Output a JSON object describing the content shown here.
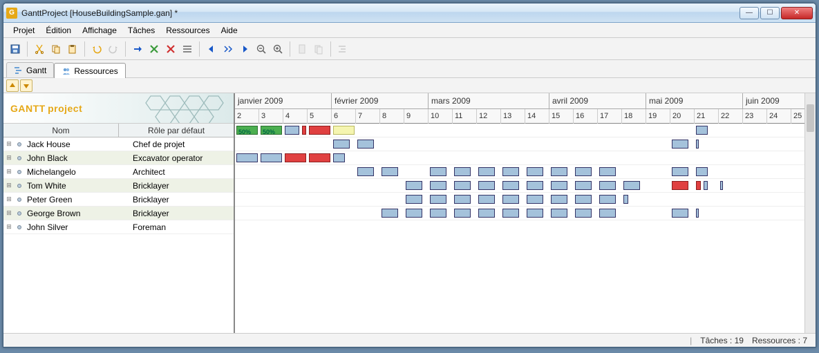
{
  "window": {
    "title": "GanttProject [HouseBuildingSample.gan] *"
  },
  "menu": {
    "projet": "Projet",
    "edition": "Édition",
    "affichage": "Affichage",
    "taches": "Tâches",
    "ressources": "Ressources",
    "aide": "Aide"
  },
  "tabs": {
    "gantt": "Gantt",
    "ressources": "Ressources"
  },
  "columns": {
    "name": "Nom",
    "role": "Rôle par défaut"
  },
  "logo": {
    "main": "GANTT",
    "sub": "project"
  },
  "resources": [
    {
      "name": "Jack House",
      "role": "Chef de projet"
    },
    {
      "name": "John Black",
      "role": "Excavator operator"
    },
    {
      "name": "Michelangelo",
      "role": "Architect"
    },
    {
      "name": "Tom White",
      "role": "Bricklayer"
    },
    {
      "name": "Peter Green",
      "role": "Bricklayer"
    },
    {
      "name": "George Brown",
      "role": "Bricklayer"
    },
    {
      "name": "John Silver",
      "role": "Foreman"
    }
  ],
  "timeline": {
    "months": [
      {
        "label": "janvier 2009",
        "span": 4
      },
      {
        "label": "février 2009",
        "span": 4
      },
      {
        "label": "mars 2009",
        "span": 5
      },
      {
        "label": "avril 2009",
        "span": 4
      },
      {
        "label": "mai 2009",
        "span": 4
      },
      {
        "label": "juin 2009",
        "span": 3
      }
    ],
    "weeks": [
      "2",
      "3",
      "4",
      "5",
      "6",
      "7",
      "8",
      "9",
      "10",
      "11",
      "12",
      "13",
      "14",
      "15",
      "16",
      "17",
      "18",
      "19",
      "20",
      "21",
      "22",
      "23",
      "24",
      "25"
    ],
    "week_width": 35
  },
  "chart_data": {
    "type": "gantt",
    "unit": "week-index",
    "rows": [
      {
        "resource": "Jack House",
        "bars": [
          {
            "start": 0,
            "span": 1,
            "color": "green",
            "label": "50%"
          },
          {
            "start": 1,
            "span": 1,
            "color": "green",
            "label": "50%"
          },
          {
            "start": 2,
            "span": 0.7,
            "color": "blue"
          },
          {
            "start": 2.7,
            "span": 0.3,
            "color": "red"
          },
          {
            "start": 3,
            "span": 1,
            "color": "red"
          },
          {
            "start": 4,
            "span": 1,
            "color": "yellow"
          },
          {
            "start": 19,
            "span": 0.6,
            "color": "blue"
          }
        ]
      },
      {
        "resource": "John Black",
        "bars": [
          {
            "start": 4,
            "span": 0.8,
            "color": "blue"
          },
          {
            "start": 5,
            "span": 0.8,
            "color": "blue"
          },
          {
            "start": 18,
            "span": 0.8,
            "color": "blue"
          },
          {
            "start": 19,
            "span": 0.15,
            "color": "blue"
          }
        ]
      },
      {
        "resource": "Michelangelo",
        "bars": [
          {
            "start": 0,
            "span": 1,
            "color": "blue"
          },
          {
            "start": 1,
            "span": 1,
            "color": "blue"
          },
          {
            "start": 2,
            "span": 1,
            "color": "red"
          },
          {
            "start": 3,
            "span": 1,
            "color": "red"
          },
          {
            "start": 4,
            "span": 0.6,
            "color": "blue"
          }
        ]
      },
      {
        "resource": "Tom White",
        "bars": [
          {
            "start": 5,
            "span": 0.8,
            "color": "blue"
          },
          {
            "start": 6,
            "span": 0.8,
            "color": "blue"
          },
          {
            "start": 8,
            "span": 0.8,
            "color": "blue"
          },
          {
            "start": 9,
            "span": 0.8,
            "color": "blue"
          },
          {
            "start": 10,
            "span": 0.8,
            "color": "blue"
          },
          {
            "start": 11,
            "span": 0.8,
            "color": "blue"
          },
          {
            "start": 12,
            "span": 0.8,
            "color": "blue"
          },
          {
            "start": 13,
            "span": 0.8,
            "color": "blue"
          },
          {
            "start": 14,
            "span": 0.8,
            "color": "blue"
          },
          {
            "start": 15,
            "span": 0.8,
            "color": "blue"
          },
          {
            "start": 18,
            "span": 0.8,
            "color": "blue"
          },
          {
            "start": 19,
            "span": 0.6,
            "color": "blue"
          }
        ]
      },
      {
        "resource": "Peter Green",
        "bars": [
          {
            "start": 7,
            "span": 0.8,
            "color": "blue"
          },
          {
            "start": 8,
            "span": 0.8,
            "color": "blue"
          },
          {
            "start": 9,
            "span": 0.8,
            "color": "blue"
          },
          {
            "start": 10,
            "span": 0.8,
            "color": "blue"
          },
          {
            "start": 11,
            "span": 0.8,
            "color": "blue"
          },
          {
            "start": 12,
            "span": 0.8,
            "color": "blue"
          },
          {
            "start": 13,
            "span": 0.8,
            "color": "blue"
          },
          {
            "start": 14,
            "span": 0.8,
            "color": "blue"
          },
          {
            "start": 15,
            "span": 0.8,
            "color": "blue"
          },
          {
            "start": 16,
            "span": 0.8,
            "color": "blue"
          },
          {
            "start": 18,
            "span": 0.8,
            "color": "red"
          },
          {
            "start": 19,
            "span": 0.3,
            "color": "red"
          },
          {
            "start": 19.3,
            "span": 0.3,
            "color": "blue"
          },
          {
            "start": 20,
            "span": 0.15,
            "color": "blue"
          }
        ]
      },
      {
        "resource": "George Brown",
        "bars": [
          {
            "start": 7,
            "span": 0.8,
            "color": "blue"
          },
          {
            "start": 8,
            "span": 0.8,
            "color": "blue"
          },
          {
            "start": 9,
            "span": 0.8,
            "color": "blue"
          },
          {
            "start": 10,
            "span": 0.8,
            "color": "blue"
          },
          {
            "start": 11,
            "span": 0.8,
            "color": "blue"
          },
          {
            "start": 12,
            "span": 0.8,
            "color": "blue"
          },
          {
            "start": 13,
            "span": 0.8,
            "color": "blue"
          },
          {
            "start": 14,
            "span": 0.8,
            "color": "blue"
          },
          {
            "start": 15,
            "span": 0.8,
            "color": "blue"
          },
          {
            "start": 16,
            "span": 0.3,
            "color": "blue"
          }
        ]
      },
      {
        "resource": "John Silver",
        "bars": [
          {
            "start": 6,
            "span": 0.8,
            "color": "blue"
          },
          {
            "start": 7,
            "span": 0.8,
            "color": "blue"
          },
          {
            "start": 8,
            "span": 0.8,
            "color": "blue"
          },
          {
            "start": 9,
            "span": 0.8,
            "color": "blue"
          },
          {
            "start": 10,
            "span": 0.8,
            "color": "blue"
          },
          {
            "start": 11,
            "span": 0.8,
            "color": "blue"
          },
          {
            "start": 12,
            "span": 0.8,
            "color": "blue"
          },
          {
            "start": 13,
            "span": 0.8,
            "color": "blue"
          },
          {
            "start": 14,
            "span": 0.8,
            "color": "blue"
          },
          {
            "start": 15,
            "span": 0.8,
            "color": "blue"
          },
          {
            "start": 18,
            "span": 0.8,
            "color": "blue"
          },
          {
            "start": 19,
            "span": 0.15,
            "color": "blue"
          }
        ]
      }
    ]
  },
  "status": {
    "tasks_label": "Tâches : 19",
    "res_label": "Ressources : 7"
  }
}
